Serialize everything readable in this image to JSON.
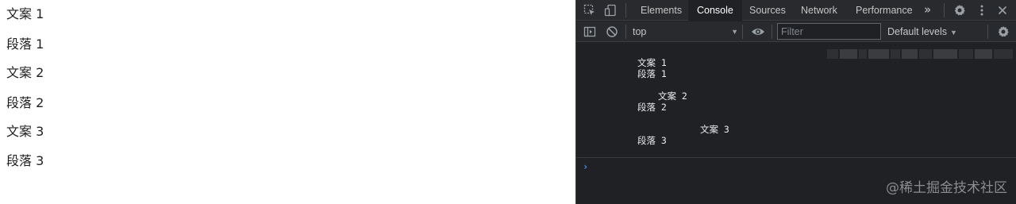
{
  "page": {
    "lines": [
      "文案 1",
      "段落 1",
      "文案 2",
      "段落 2",
      "文案 3",
      "段落 3"
    ]
  },
  "devtools": {
    "tabs": {
      "elements": "Elements",
      "console": "Console",
      "sources": "Sources",
      "network": "Network",
      "performance": "Performance",
      "more": "»"
    },
    "toolbar": {
      "context": "top",
      "filter_placeholder": "Filter",
      "levels": "Default levels"
    },
    "console_logs": [
      "文案 1",
      "段落 1",
      "文案 2",
      "段落 2",
      "文案 3",
      "段落 3"
    ],
    "prompt": "›",
    "watermark": "@稀土掘金技术社区"
  },
  "colors": {
    "devtools_bg": "#202124",
    "toolbar_bg": "#292a2d",
    "text_primary": "#e8eaed",
    "prompt_accent": "#4c8df6"
  },
  "icons": [
    "inspect-icon",
    "device-toggle-icon",
    "settings-icon",
    "more-vert-icon",
    "close-icon",
    "sidebar-toggle-icon",
    "clear-console-icon",
    "eye-icon",
    "console-settings-icon"
  ]
}
